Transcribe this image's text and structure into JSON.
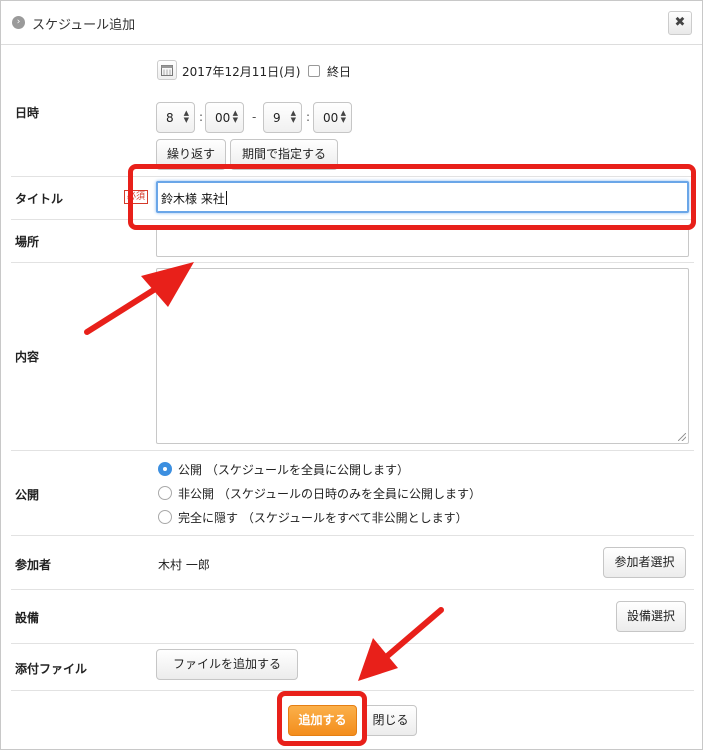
{
  "dialog": {
    "title": "スケジュール追加",
    "close_symbol": "✖"
  },
  "datetime": {
    "label": "日時",
    "date": "2017年12月11日(月)",
    "all_day_label": "終日",
    "all_day_checked": false,
    "start_hour": "8",
    "start_minute": "00",
    "end_hour": "9",
    "end_minute": "00",
    "colon": ":",
    "dash": "-",
    "repeat_button": "繰り返す",
    "period_button": "期間で指定する"
  },
  "title_field": {
    "label": "タイトル",
    "required_badge": "必須",
    "value": "鈴木様 来社"
  },
  "place_field": {
    "label": "場所",
    "value": ""
  },
  "content_field": {
    "label": "内容",
    "value": ""
  },
  "publish": {
    "label": "公開",
    "options": [
      {
        "label": "公開 （スケジュールを全員に公開します）",
        "selected": true
      },
      {
        "label": "非公開 （スケジュールの日時のみを全員に公開します）",
        "selected": false
      },
      {
        "label": "完全に隠す （スケジュールをすべて非公開とします）",
        "selected": false
      }
    ]
  },
  "participants": {
    "label": "参加者",
    "value": "木村 一郎",
    "select_button": "参加者選択"
  },
  "equipment": {
    "label": "設備",
    "select_button": "設備選択"
  },
  "attachments": {
    "label": "添付ファイル",
    "add_button": "ファイルを追加する"
  },
  "footer": {
    "add_button": "追加する",
    "close_button": "閉じる"
  },
  "annotation_color": "#e8201a",
  "accent_color": "#f38d1c"
}
